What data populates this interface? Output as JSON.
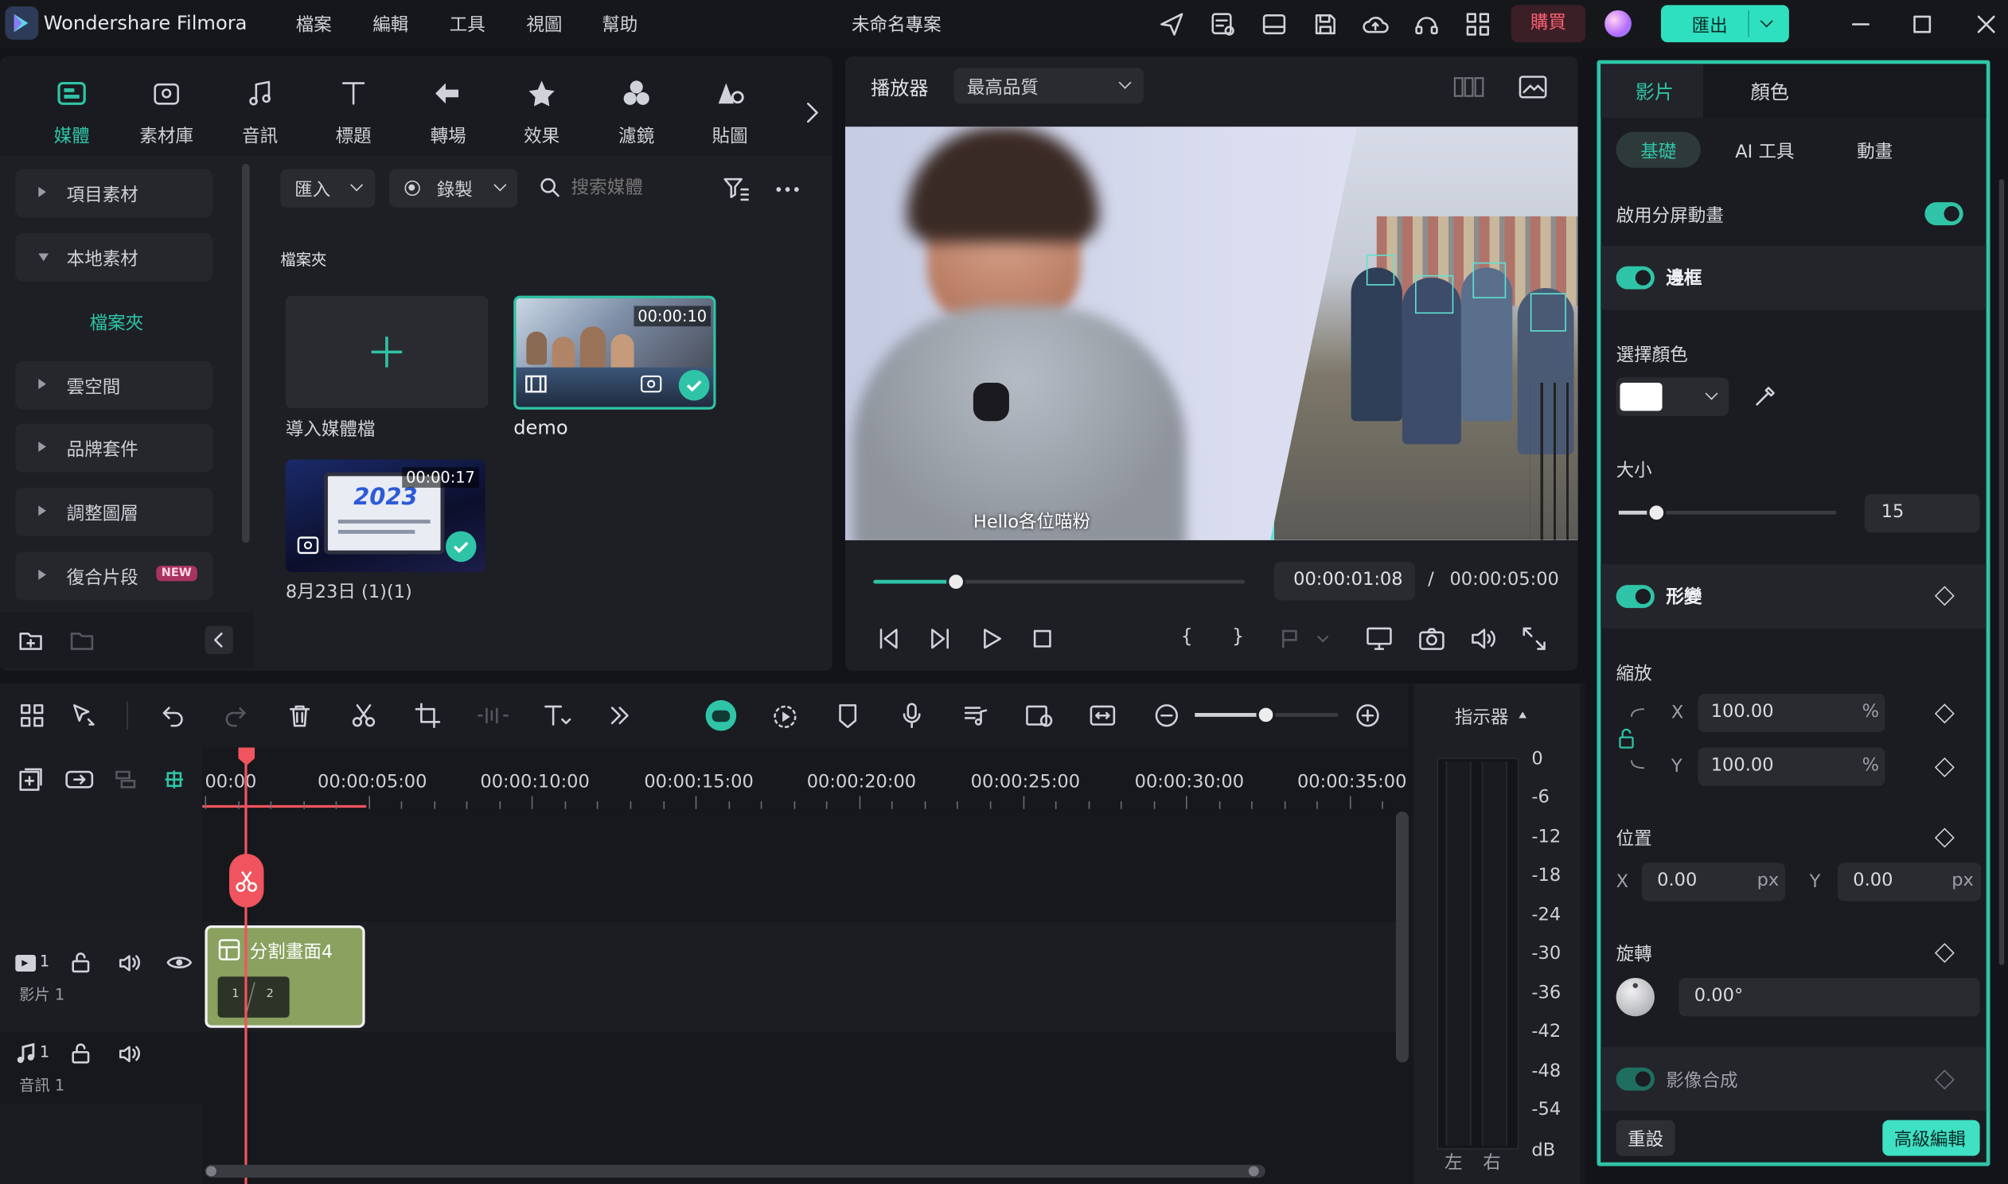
{
  "app": {
    "title": "Wondershare Filmora",
    "project_title": "未命名專案"
  },
  "menu": [
    "檔案",
    "編輯",
    "工具",
    "視圖",
    "幫助"
  ],
  "header": {
    "buy_label": "購買",
    "export_label": "匯出"
  },
  "media_tabs": [
    {
      "label": "媒體",
      "icon": "media-icon"
    },
    {
      "label": "素材庫",
      "icon": "library-icon"
    },
    {
      "label": "音訊",
      "icon": "music-icon"
    },
    {
      "label": "標題",
      "icon": "title-icon"
    },
    {
      "label": "轉場",
      "icon": "transition-icon"
    },
    {
      "label": "效果",
      "icon": "effects-icon"
    },
    {
      "label": "濾鏡",
      "icon": "filters-icon"
    },
    {
      "label": "貼圖",
      "icon": "stickers-icon"
    }
  ],
  "sidebar": {
    "items": [
      {
        "label": "項目素材"
      },
      {
        "label": "本地素材"
      },
      {
        "label": "檔案夾"
      },
      {
        "label": "雲空間"
      },
      {
        "label": "品牌套件"
      },
      {
        "label": "調整圖層"
      },
      {
        "label": "復合片段",
        "badge": "NEW"
      }
    ]
  },
  "media_toolbar": {
    "import_label": "匯入",
    "record_label": "錄製",
    "search_placeholder": "搜索媒體"
  },
  "media_area": {
    "folder_heading": "檔案夾",
    "import_tile_label": "導入媒體檔",
    "clips": [
      {
        "name": "demo",
        "duration": "00:00:10"
      },
      {
        "name": "8月23日 (1)(1)",
        "duration": "00:00:17",
        "thumb_text": "2023"
      }
    ]
  },
  "player": {
    "label": "播放器",
    "quality": "最高品質",
    "subtitle": "Hello各位喵粉",
    "current_time": "00:00:01:08",
    "separator": "/",
    "total_time": "00:00:05:00",
    "progress": 0.22
  },
  "inspector": {
    "tabs": [
      "影片",
      "顏色"
    ],
    "subtabs": [
      "基礎",
      "AI 工具",
      "動畫"
    ],
    "split_anim_label": "啟用分屏動畫",
    "border_label": "邊框",
    "color_label": "選擇顏色",
    "size_label": "大小",
    "size_value": "15",
    "transform_label": "形變",
    "scale_label": "縮放",
    "scale_x": "100.00",
    "scale_y": "100.00",
    "unit_pct": "%",
    "position_label": "位置",
    "pos_x": "0.00",
    "pos_y": "0.00",
    "unit_px": "px",
    "x_label": "X",
    "y_label": "Y",
    "rotate_label": "旋轉",
    "rotate_value": "0.00°",
    "composite_label": "影像合成",
    "reset_label": "重設",
    "advanced_label": "高級編輯"
  },
  "timeline": {
    "indicator_label": "指示器",
    "ruler": [
      "00:00",
      "00:00:05:00",
      "00:00:10:00",
      "00:00:15:00",
      "00:00:20:00",
      "00:00:25:00",
      "00:00:30:00",
      "00:00:35:00"
    ],
    "tracks": [
      {
        "index": "1",
        "name": "影片 1"
      },
      {
        "index": "1",
        "name": "音訊 1"
      }
    ],
    "clip": {
      "title": "分割畫面4",
      "cells": [
        "1",
        "2"
      ]
    },
    "meter_scale": [
      "0",
      "-6",
      "-12",
      "-18",
      "-24",
      "-30",
      "-36",
      "-42",
      "-48",
      "-54",
      "dB"
    ],
    "meter_channels": [
      "左",
      "右"
    ]
  },
  "colors": {
    "accent": "#2fc4a7",
    "buy": "#ff5f73",
    "clip": "#8aa160",
    "playhead": "#f0545e"
  }
}
